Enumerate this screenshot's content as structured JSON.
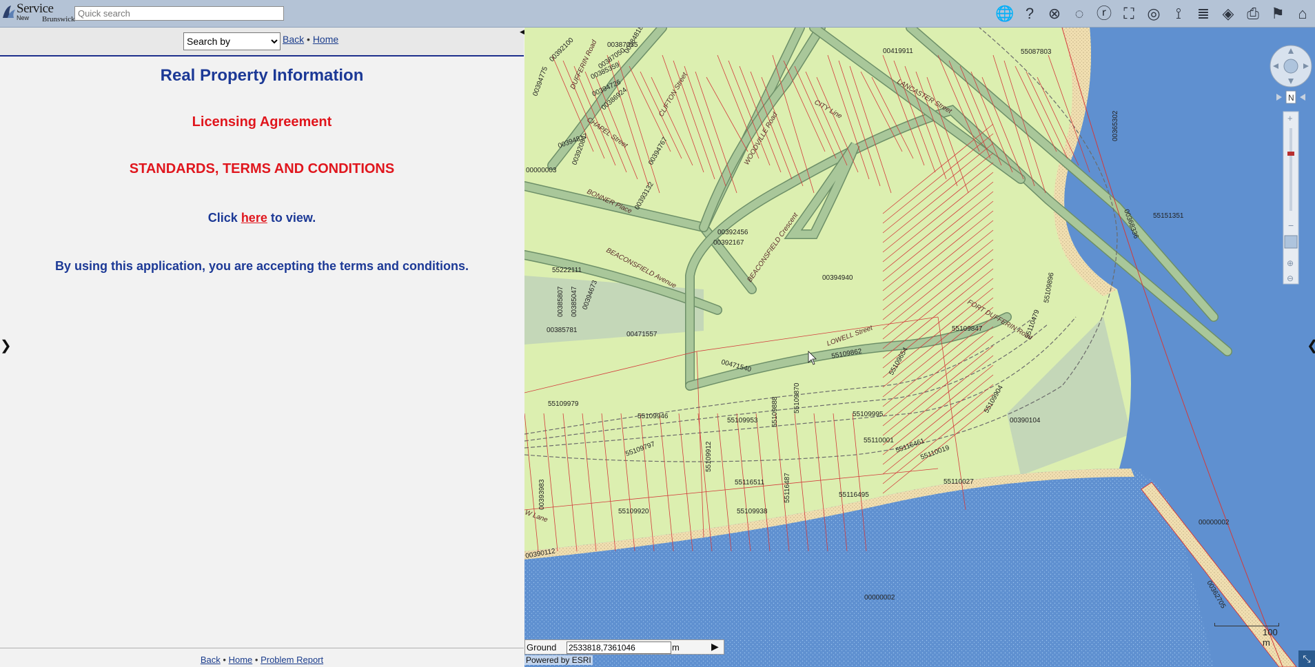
{
  "header": {
    "logo_word": "Service",
    "logo_sub_left": "New",
    "logo_sub_right": "Brunswick",
    "search_placeholder": "Quick search",
    "tools": [
      {
        "name": "globe-icon",
        "glyph": "🌐"
      },
      {
        "name": "identify-help-icon",
        "glyph": "?"
      },
      {
        "name": "clear-icon",
        "glyph": "⊗"
      },
      {
        "name": "lasso-select-icon",
        "glyph": "◌"
      },
      {
        "name": "identify-icon",
        "glyph": "ⓡ"
      },
      {
        "name": "extent-icon",
        "glyph": "⛶"
      },
      {
        "name": "overview-icon",
        "glyph": "◎"
      },
      {
        "name": "measure-icon",
        "glyph": "⟟"
      },
      {
        "name": "layers-icon",
        "glyph": "≣"
      },
      {
        "name": "basemap-icon",
        "glyph": "◈"
      },
      {
        "name": "print-icon",
        "glyph": "⎙"
      },
      {
        "name": "help-guide-icon",
        "glyph": "⚑"
      },
      {
        "name": "home-icon",
        "glyph": "⌂"
      }
    ]
  },
  "left_panel": {
    "search_by_label": "Search by",
    "nav_back": "Back",
    "nav_sep": "•",
    "nav_home": "Home",
    "title": "Real Property Information",
    "licensing": "Licensing Agreement",
    "standards": "STANDARDS, TERMS AND CONDITIONS",
    "click_prefix": "Click",
    "click_link": "here",
    "click_suffix": "to view.",
    "accept_text": "By using this application, you are accepting the terms and conditions.",
    "footer_back": "Back",
    "footer_home": "Home",
    "footer_problem": "Problem Report"
  },
  "map": {
    "colors": {
      "land": "#dcefb0",
      "parcel_line": "#d23a3a",
      "road": "#a9c79a",
      "road_edge": "#6d8f68",
      "water": "#5f90d0",
      "water_dots": "#9cc4ee",
      "beach": "#f0deb0",
      "grey_parcel": "#c4d7b8"
    },
    "parcel_labels": [
      "00387035",
      "00384818",
      "00392100",
      "00387050",
      "00394775",
      "00385359",
      "00394726",
      "00386924",
      "00394817",
      "00392084",
      "00000003",
      "00394767",
      "00393132",
      "55222111",
      "00385807",
      "00385047",
      "00394673",
      "00385781",
      "00471557",
      "00471540",
      "00392456",
      "00392167",
      "00394940",
      "00419911",
      "55087803",
      "00365302",
      "00368336",
      "55151351",
      "55109847",
      "55109862",
      "55109654",
      "55109979",
      "55109946",
      "55109953",
      "55109888",
      "55109870",
      "55109995",
      "55110001",
      "55116461",
      "55110019",
      "55109904",
      "00390104",
      "55109797",
      "55109912",
      "55116511",
      "55116495",
      "55110027",
      "55109920",
      "55109938",
      "55116487",
      "00393983",
      "00390112",
      "00000002",
      "00000002",
      "55109896",
      "55110479",
      "00362705"
    ],
    "street_labels": [
      "DUFFERIN Road",
      "CHAPEL Street",
      "CLIFTON Street",
      "WOODVILLE Road",
      "BONNER Place",
      "BEACONSFIELD Avenue",
      "BEACONSFIELD Crescent",
      "CITY Line",
      "LANCASTER Street",
      "LOWELL Street",
      "FORT DUFFERIN Road",
      "W Lane"
    ],
    "coord_label": "Ground",
    "coord_value": "2533818,7361046",
    "coord_unit": "m",
    "powered_by": "Powered by ESRI",
    "scale_label": "100 m",
    "compass_north": "N"
  }
}
